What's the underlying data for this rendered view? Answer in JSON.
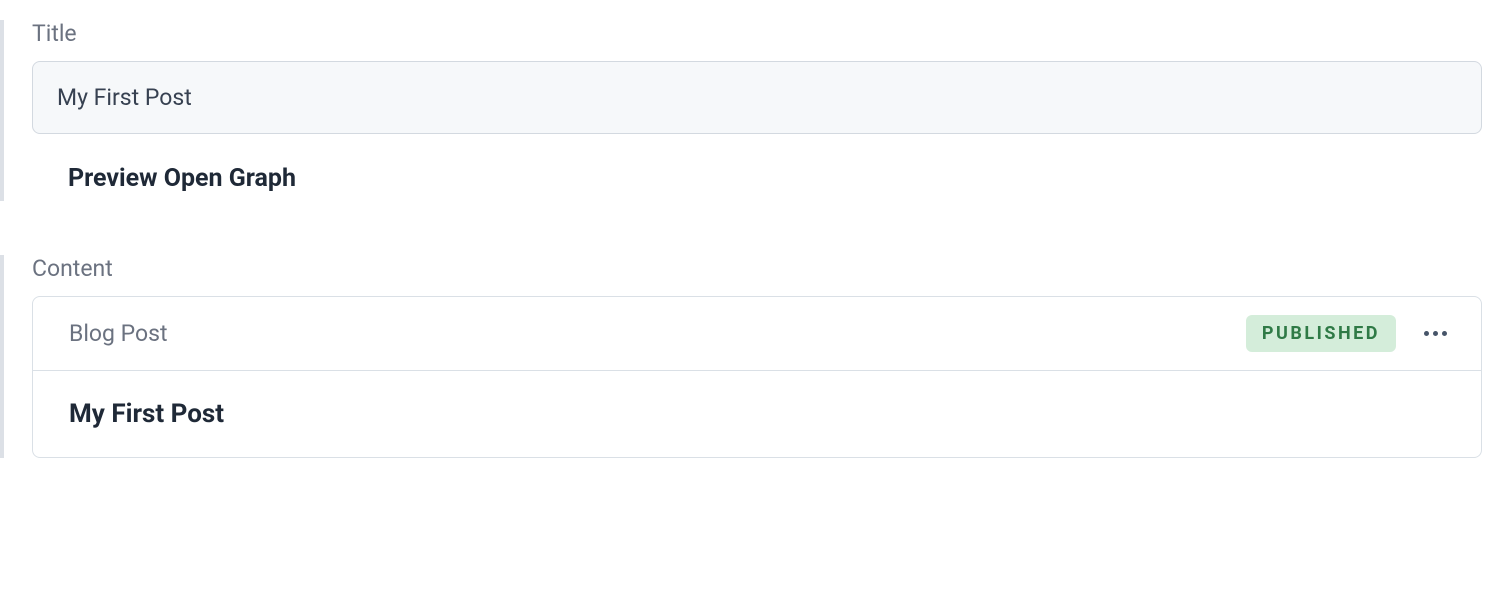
{
  "titleSection": {
    "label": "Title",
    "value": "My First Post",
    "previewHeading": "Preview Open Graph"
  },
  "contentSection": {
    "label": "Content",
    "card": {
      "type": "Blog Post",
      "status": "PUBLISHED",
      "title": "My First Post"
    }
  }
}
